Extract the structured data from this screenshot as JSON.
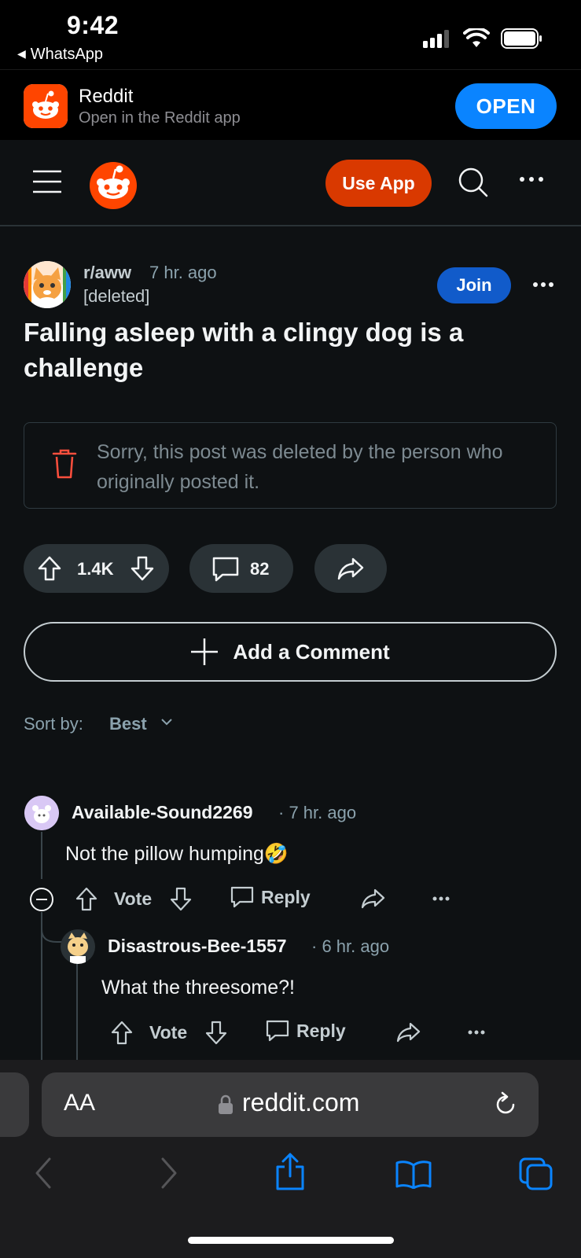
{
  "status_bar": {
    "time": "9:42",
    "back_label": "WhatsApp"
  },
  "app_banner": {
    "title": "Reddit",
    "subtitle": "Open in the Reddit app",
    "open_label": "OPEN"
  },
  "header": {
    "use_app_label": "Use App"
  },
  "post": {
    "subreddit": "r/aww",
    "time": "7 hr. ago",
    "author": "[deleted]",
    "join_label": "Join",
    "title": "Falling asleep with a clingy dog is a challenge",
    "deleted_notice": "Sorry, this post was deleted by the person who originally posted it.",
    "score": "1.4K",
    "comment_count": "82",
    "add_comment_label": "Add a Comment"
  },
  "sort": {
    "label": "Sort by:",
    "value": "Best"
  },
  "comments": [
    {
      "username": "Available-Sound2269",
      "time": "7 hr. ago",
      "body": "Not the pillow humping🤣",
      "vote_label": "Vote",
      "reply_label": "Reply"
    },
    {
      "username": "Disastrous-Bee-1557",
      "time": "6 hr. ago",
      "body": "What the threesome?!",
      "vote_label": "Vote",
      "reply_label": "Reply"
    }
  ],
  "safari": {
    "text_size_label": "AA",
    "url": "reddit.com"
  },
  "colors": {
    "background": "#0e1113",
    "brand_orange": "#ff4500",
    "use_app": "#d93900",
    "join": "#115bca",
    "open": "#0a84ff",
    "safari_blue": "#0a84ff"
  }
}
